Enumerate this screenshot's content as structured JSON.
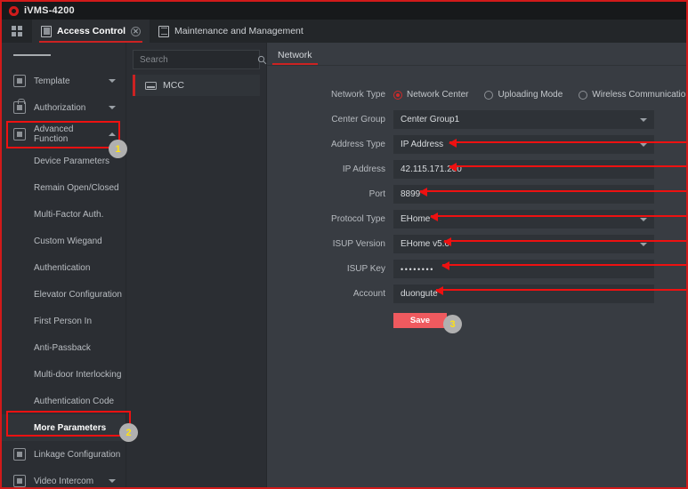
{
  "window": {
    "app_title": "iVMS-4200",
    "logo_icon": "hikvision-logo-icon"
  },
  "tabbar": {
    "grid_icon": "grid-menu-icon",
    "tabs": [
      {
        "label": "Access Control",
        "icon": "access-control-icon",
        "active": true,
        "closable": true,
        "close_icon": "close-icon"
      },
      {
        "label": "Maintenance and Management",
        "icon": "maintenance-icon",
        "active": false,
        "closable": false
      }
    ]
  },
  "sidebar": {
    "menu_icon": "hamburger-icon",
    "items": [
      {
        "label": "Template",
        "icon": "template-icon",
        "caret": "chevron-down-icon",
        "type": "group"
      },
      {
        "label": "Authorization",
        "icon": "lock-icon",
        "caret": "chevron-down-icon",
        "type": "group"
      },
      {
        "label": "Advanced Function",
        "icon": "advanced-function-icon",
        "caret": "chevron-up-icon",
        "type": "group",
        "highlighted": true
      },
      {
        "label": "Device Parameters",
        "type": "sub"
      },
      {
        "label": "Remain Open/Closed",
        "type": "sub"
      },
      {
        "label": "Multi-Factor Auth.",
        "type": "sub"
      },
      {
        "label": "Custom Wiegand",
        "type": "sub"
      },
      {
        "label": "Authentication",
        "type": "sub"
      },
      {
        "label": "Elevator Configuration",
        "type": "sub"
      },
      {
        "label": "First Person In",
        "type": "sub"
      },
      {
        "label": "Anti-Passback",
        "type": "sub"
      },
      {
        "label": "Multi-door Interlocking",
        "type": "sub"
      },
      {
        "label": "Authentication Code",
        "type": "sub"
      },
      {
        "label": "More Parameters",
        "type": "sub",
        "selected": true,
        "highlighted": true
      },
      {
        "label": "Linkage Configuration",
        "icon": "linkage-icon",
        "type": "group"
      },
      {
        "label": "Video Intercom",
        "icon": "video-intercom-icon",
        "caret": "chevron-down-icon",
        "type": "group"
      }
    ]
  },
  "device_list": {
    "search": {
      "placeholder": "Search",
      "value": "",
      "icon": "search-icon"
    },
    "items": [
      {
        "label": "MCC",
        "icon": "device-icon",
        "selected": true
      }
    ]
  },
  "panel": {
    "tabs": [
      {
        "label": "Network",
        "active": true
      }
    ],
    "network_type": {
      "label": "Network Type",
      "options": [
        {
          "label": "Network Center",
          "selected": true
        },
        {
          "label": "Uploading Mode",
          "selected": false
        },
        {
          "label": "Wireless Communication Center",
          "selected": false
        }
      ]
    },
    "fields": [
      {
        "name": "center-group",
        "label": "Center Group",
        "value": "Center Group1",
        "kind": "select",
        "arrow": false
      },
      {
        "name": "address-type",
        "label": "Address Type",
        "value": "IP Address",
        "kind": "select",
        "arrow": true
      },
      {
        "name": "ip-address",
        "label": "IP Address",
        "value": "42.115.171.200",
        "kind": "text",
        "arrow": true
      },
      {
        "name": "port",
        "label": "Port",
        "value": "8899",
        "kind": "text",
        "arrow": true
      },
      {
        "name": "protocol-type",
        "label": "Protocol Type",
        "value": "EHome",
        "kind": "select",
        "arrow": true
      },
      {
        "name": "isup-version",
        "label": "ISUP Version",
        "value": "EHome v5.0",
        "kind": "select",
        "arrow": true
      },
      {
        "name": "isup-key",
        "label": "ISUP Key",
        "value": "••••••••",
        "kind": "password",
        "arrow": true
      },
      {
        "name": "account",
        "label": "Account",
        "value": "duongute",
        "kind": "text",
        "arrow": true
      }
    ],
    "save_label": "Save"
  },
  "annotations": {
    "badges": [
      {
        "number": "1",
        "target": "advanced-function"
      },
      {
        "number": "2",
        "target": "more-parameters"
      },
      {
        "number": "3",
        "target": "save-button"
      }
    ]
  },
  "colors": {
    "accent_red": "#cc2222",
    "annotation_red": "#ee1111",
    "save_button": "#ef5a5f",
    "badge_bg": "#b0b0b0",
    "badge_text": "#ffe213",
    "panel_bg": "#383c42",
    "sidebar_bg": "#2b2e33",
    "titlebar_bg": "#17191b"
  }
}
